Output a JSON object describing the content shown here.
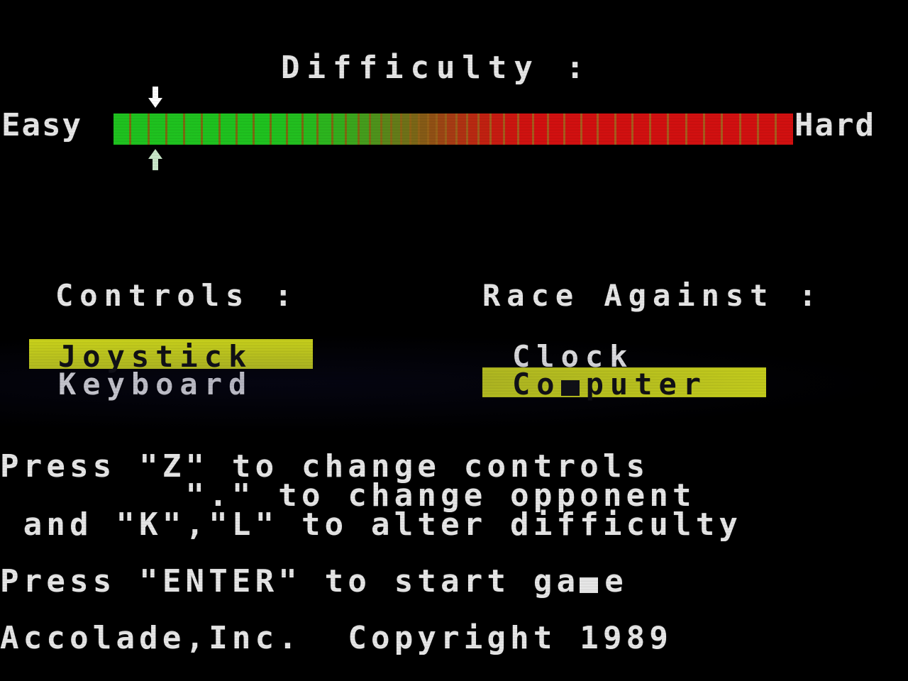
{
  "screen": {
    "background_color": "#000000",
    "text_color": "#e6e6e6",
    "highlight_color": "#cbd41a",
    "highlight_text_color": "#101010"
  },
  "difficulty": {
    "title": "Difficulty :",
    "easy_label": "Easy",
    "hard_label": "Hard",
    "cursor_position_index": 2,
    "segment_count": 46,
    "gauge_start_color": "#1fc21f",
    "gauge_end_color": "#d21010",
    "separator_start_color": "#7a6a10",
    "separator_end_color": "#a85a1c",
    "cursor_top_icon": "arrow-down-icon",
    "cursor_bottom_icon": "arrow-up-icon",
    "cursor_top_color": "#ffffff",
    "cursor_bottom_color": "#c8e6c8"
  },
  "controls": {
    "heading": "Controls :",
    "options": [
      {
        "label": "Joystick",
        "selected": true
      },
      {
        "label": "Keyboard",
        "selected": false
      }
    ]
  },
  "race_against": {
    "heading": "Race Against :",
    "options": [
      {
        "label": "Clock",
        "selected": false
      },
      {
        "label": "Computer",
        "selected": true,
        "glitch_char_index": 2
      }
    ]
  },
  "instructions": {
    "line_1": "Press \"Z\" to change controls",
    "line_2": "        \".\" to change opponent",
    "line_3": " and \"K\",\"L\" to alter difficulty",
    "start_line": "Press \"ENTER\" to start game",
    "start_line_prefix": "Press \"ENTER\" to start ga",
    "start_line_suffix": "e"
  },
  "footer": {
    "copyright": "Accolade,Inc.  Copyright 1989"
  }
}
